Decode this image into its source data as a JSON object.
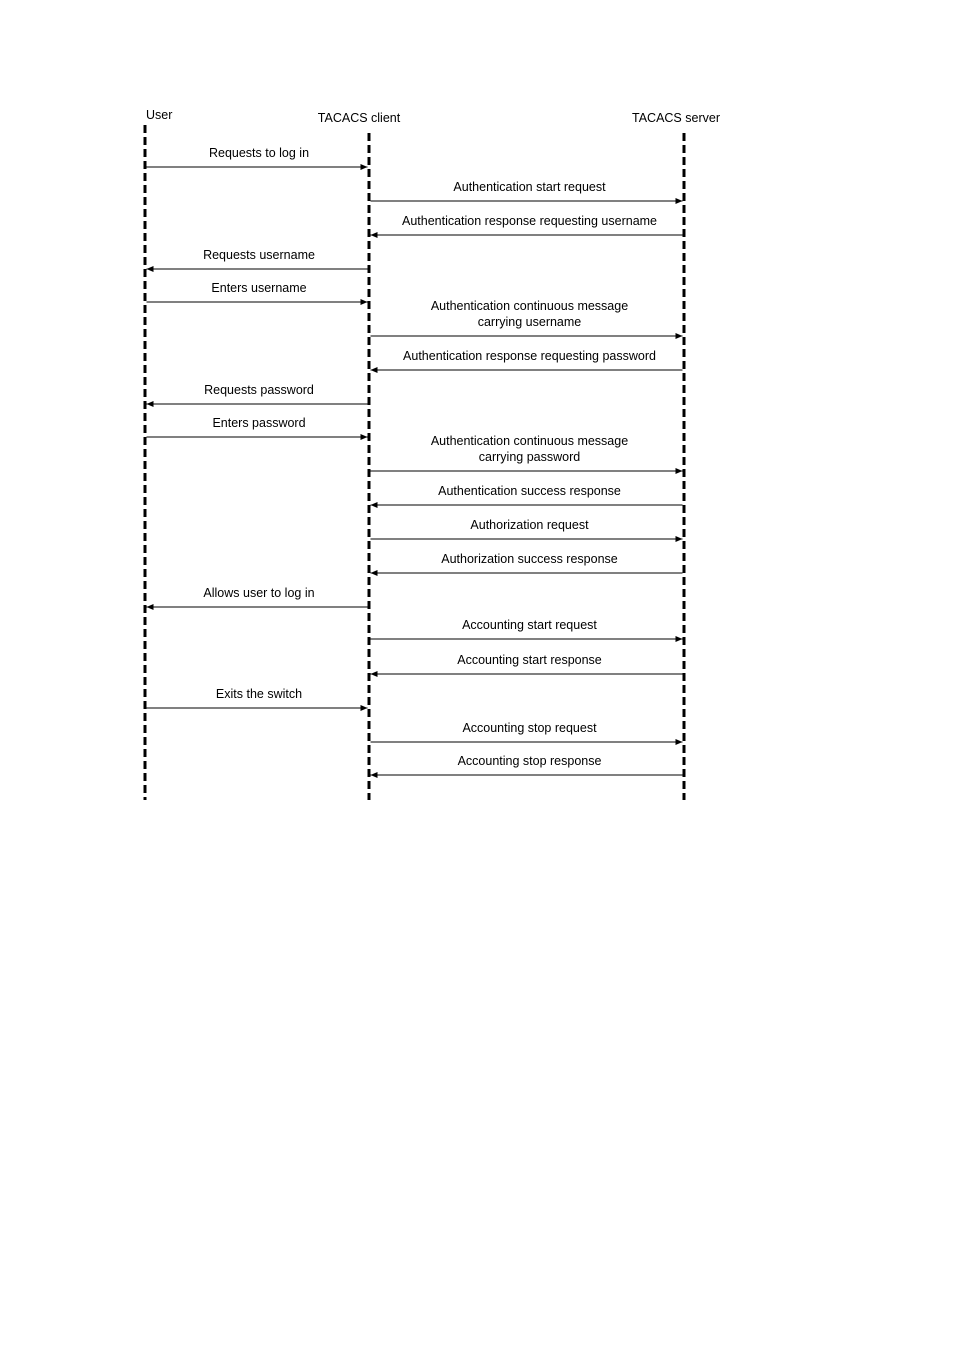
{
  "diagram": {
    "type": "sequence",
    "participants": [
      {
        "id": "user",
        "label": "User"
      },
      {
        "id": "client",
        "label": "TACACS client"
      },
      {
        "id": "server",
        "label": "TACACS server"
      }
    ],
    "messages": [
      {
        "from": "user",
        "to": "client",
        "lines": [
          "Requests to log in"
        ]
      },
      {
        "from": "client",
        "to": "server",
        "lines": [
          "Authentication start request"
        ]
      },
      {
        "from": "server",
        "to": "client",
        "lines": [
          "Authentication response requesting username"
        ]
      },
      {
        "from": "client",
        "to": "user",
        "lines": [
          "Requests username"
        ]
      },
      {
        "from": "user",
        "to": "client",
        "lines": [
          "Enters username"
        ]
      },
      {
        "from": "client",
        "to": "server",
        "lines": [
          "Authentication continuous message",
          "carrying username"
        ]
      },
      {
        "from": "server",
        "to": "client",
        "lines": [
          "Authentication response requesting password"
        ]
      },
      {
        "from": "client",
        "to": "user",
        "lines": [
          "Requests password"
        ]
      },
      {
        "from": "user",
        "to": "client",
        "lines": [
          "Enters password"
        ]
      },
      {
        "from": "client",
        "to": "server",
        "lines": [
          "Authentication continuous message",
          "carrying password"
        ]
      },
      {
        "from": "server",
        "to": "client",
        "lines": [
          "Authentication success response"
        ]
      },
      {
        "from": "client",
        "to": "server",
        "lines": [
          "Authorization request"
        ]
      },
      {
        "from": "server",
        "to": "client",
        "lines": [
          "Authorization success response"
        ]
      },
      {
        "from": "client",
        "to": "user",
        "lines": [
          "Allows user to log in"
        ]
      },
      {
        "from": "client",
        "to": "server",
        "lines": [
          "Accounting start request"
        ]
      },
      {
        "from": "server",
        "to": "client",
        "lines": [
          "Accounting start response"
        ]
      },
      {
        "from": "user",
        "to": "client",
        "lines": [
          "Exits the switch"
        ]
      },
      {
        "from": "client",
        "to": "server",
        "lines": [
          "Accounting stop request"
        ]
      },
      {
        "from": "server",
        "to": "client",
        "lines": [
          "Accounting stop response"
        ]
      }
    ]
  }
}
